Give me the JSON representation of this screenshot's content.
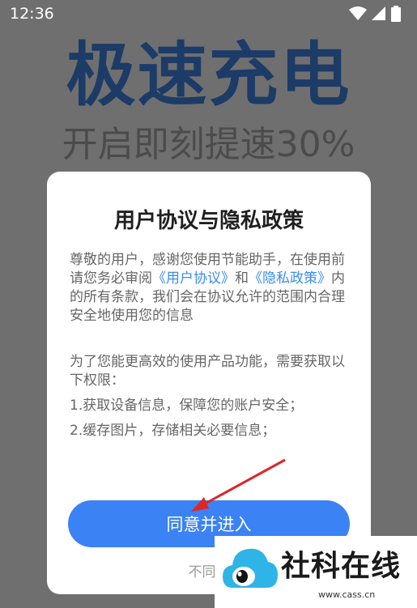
{
  "status": {
    "time": "12:36"
  },
  "background": {
    "title": "极速充电",
    "subtitle": "开启即刻提速30%"
  },
  "dialog": {
    "title": "用户协议与隐私政策",
    "intro_part1": "尊敬的用户，感谢您使用节能助手，在使用前请您务必审阅",
    "user_agreement_link": "《用户协议》",
    "and": "和",
    "privacy_link": "《隐私政策》",
    "intro_part2": "内的所有条款，我们会在协议允许的范围内合理安全地使用您的信息",
    "permission_intro": "为了您能更高效的使用产品功能，需要获取以下权限：",
    "permissions": [
      "1.获取设备信息，保障您的账户安全；",
      "2.缓存图片，存储相关必要信息；"
    ],
    "agree_label": "同意并进入",
    "disagree_label": "不同意"
  },
  "watermark": {
    "text": "社科在线",
    "url": "www.cass.cn"
  },
  "colors": {
    "accent": "#3b82f5",
    "link": "#3a8bf2",
    "annotation_arrow": "#e02525"
  }
}
